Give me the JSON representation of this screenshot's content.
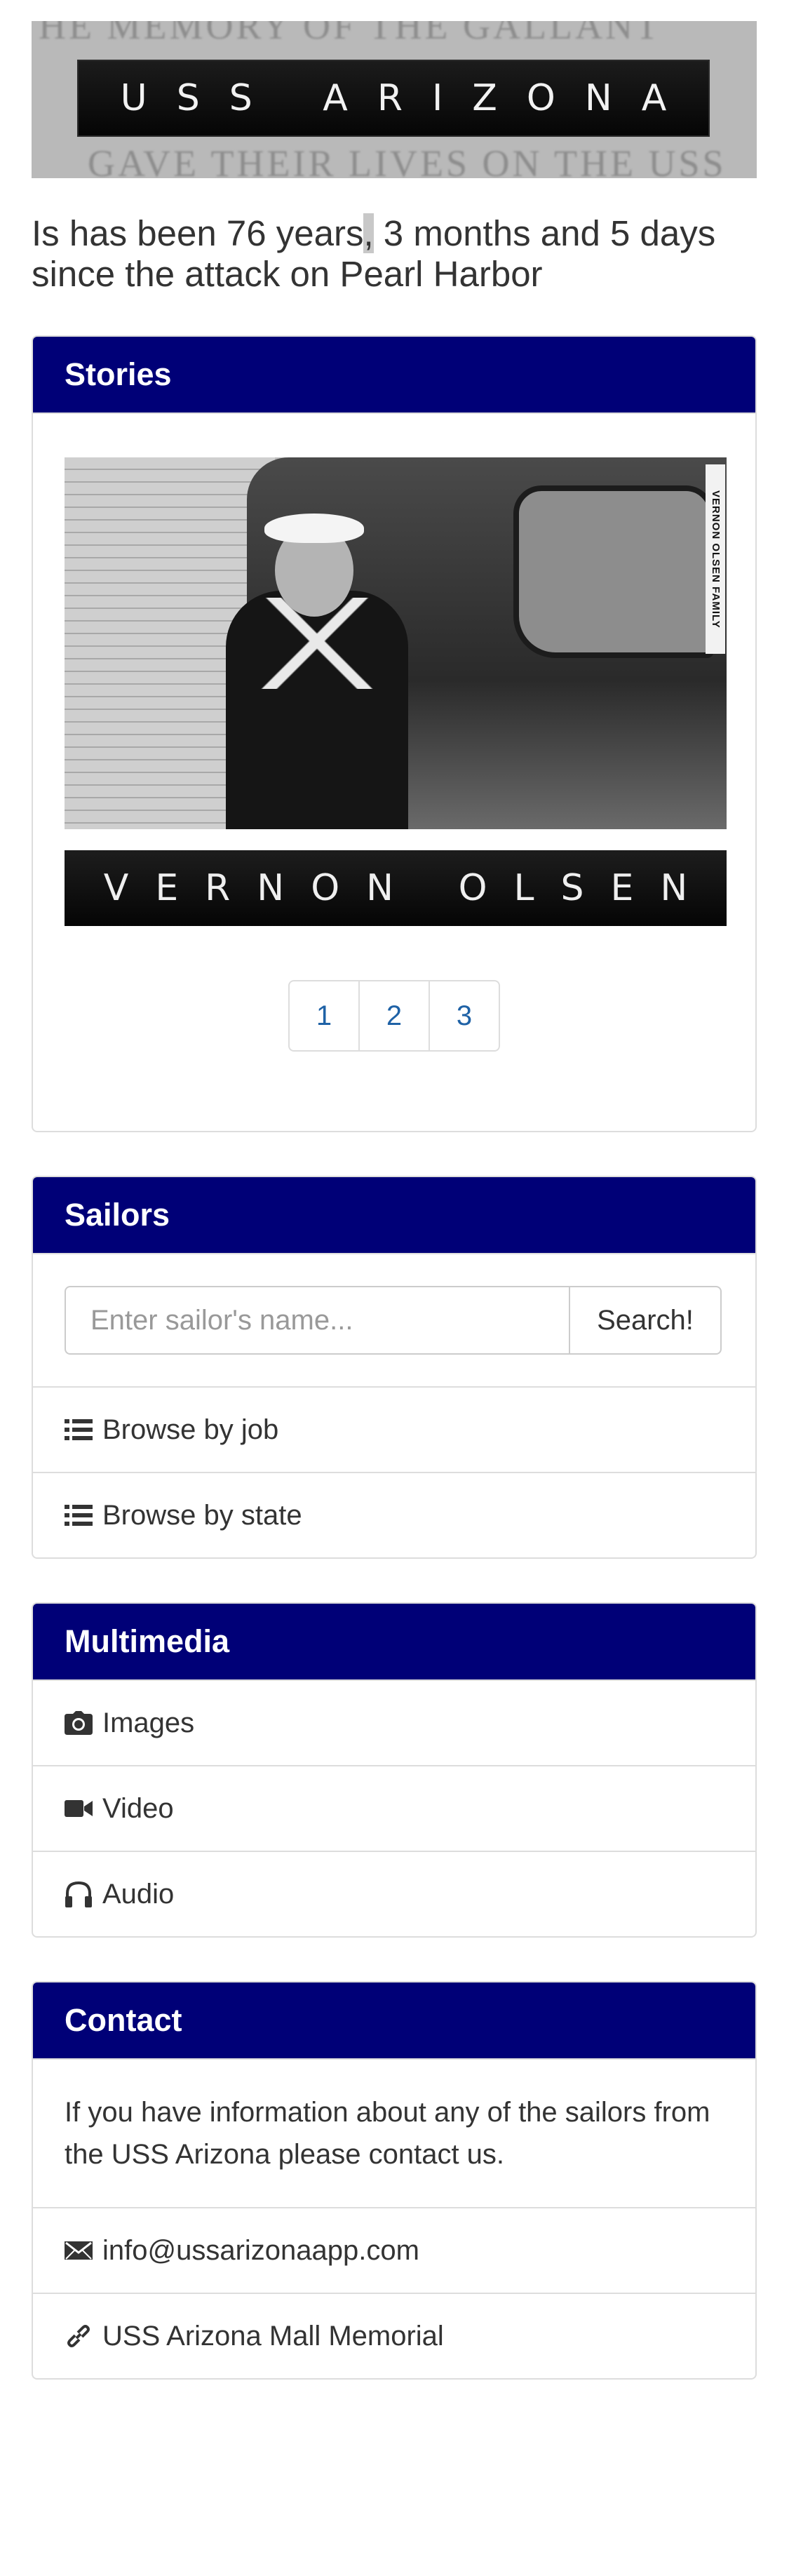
{
  "banner": {
    "title": "USS ARIZONA",
    "bg_text_top": "HE MEMORY OF THE GALLANT",
    "bg_text_bottom": "GAVE THEIR LIVES ON THE USS"
  },
  "countdown": {
    "text_before_mark": "Is has been 76 years",
    "marked_char": ",",
    "text_after_mark": " 3 months and 5 days since the attack on Pearl Harbor"
  },
  "stories": {
    "heading": "Stories",
    "photo_credit": "VERNON OLSEN FAMILY",
    "name": "VERNON OLSEN",
    "pages": [
      "1",
      "2",
      "3"
    ]
  },
  "sailors": {
    "heading": "Sailors",
    "search_placeholder": "Enter sailor's name...",
    "search_button": "Search!",
    "items": [
      {
        "label": "Browse by job",
        "icon": "list-icon"
      },
      {
        "label": "Browse by state",
        "icon": "list-icon"
      }
    ]
  },
  "multimedia": {
    "heading": "Multimedia",
    "items": [
      {
        "label": "Images",
        "icon": "camera-icon"
      },
      {
        "label": "Video",
        "icon": "video-camera-icon"
      },
      {
        "label": "Audio",
        "icon": "headphones-icon"
      }
    ]
  },
  "contact": {
    "heading": "Contact",
    "text": "If you have information about any of the sailors from the USS Arizona please contact us.",
    "items": [
      {
        "label": "info@ussarizonaapp.com",
        "icon": "envelope-icon"
      },
      {
        "label": "USS Arizona Mall Memorial",
        "icon": "link-icon"
      }
    ]
  },
  "colors": {
    "panel_heading": "#000077",
    "link": "#1f62a6",
    "border": "#dddddd"
  }
}
